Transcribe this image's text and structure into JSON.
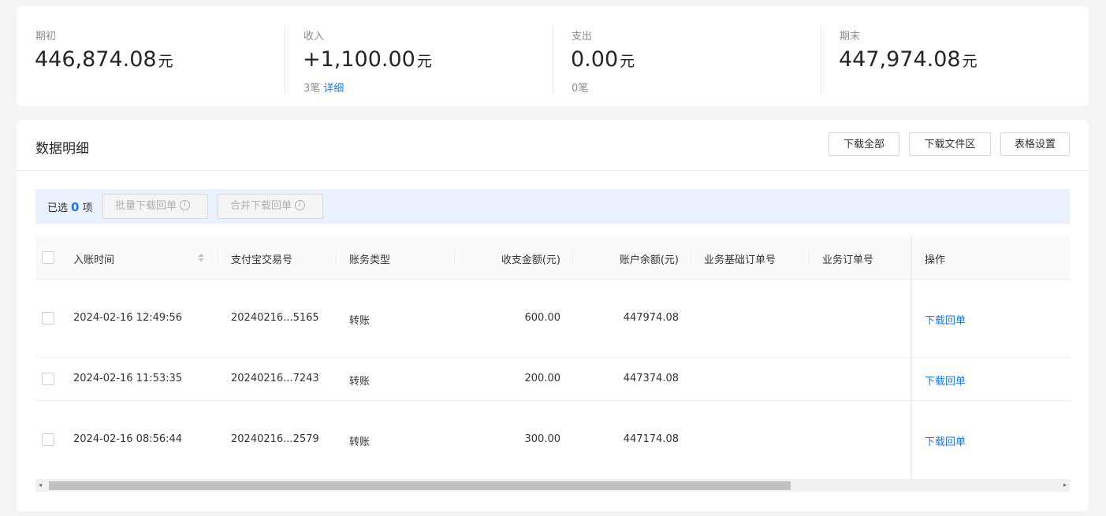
{
  "summary": {
    "opening": {
      "label": "期初",
      "amount": "446,874.08",
      "unit": "元"
    },
    "income": {
      "label": "收入",
      "amount": "+1,100.00",
      "unit": "元",
      "count": "3笔",
      "detail_link": "详细"
    },
    "expense": {
      "label": "支出",
      "amount": "0.00",
      "unit": "元",
      "count": "0笔"
    },
    "closing": {
      "label": "期末",
      "amount": "447,974.08",
      "unit": "元"
    }
  },
  "detail": {
    "title": "数据明细",
    "buttons": {
      "download_all": "下载全部",
      "download_files": "下载文件区",
      "table_settings": "表格设置"
    }
  },
  "selection": {
    "prefix": "已选",
    "count": "0",
    "suffix": "项",
    "batch_download": "批量下载回单",
    "merge_download": "合并下载回单"
  },
  "table": {
    "columns": [
      "入账时间",
      "支付宝交易号",
      "账务类型",
      "收支金额(元)",
      "账户余额(元)",
      "业务基础订单号",
      "业务订单号",
      "操作"
    ],
    "rows": [
      {
        "time": "2024-02-16 12:49:56",
        "trade_no": "20240216...5165",
        "type": "转账",
        "amount": "600.00",
        "balance": "447974.08",
        "base_order": "",
        "order": "",
        "action": "下载回单"
      },
      {
        "time": "2024-02-16 11:53:35",
        "trade_no": "20240216...7243",
        "type": "转账",
        "amount": "200.00",
        "balance": "447374.08",
        "base_order": "",
        "order": "",
        "action": "下载回单"
      },
      {
        "time": "2024-02-16 08:56:44",
        "trade_no": "20240216...2579",
        "type": "转账",
        "amount": "300.00",
        "balance": "447174.08",
        "base_order": "",
        "order": "",
        "action": "下载回单"
      }
    ]
  },
  "scrollbar": {
    "position": 0.0
  }
}
